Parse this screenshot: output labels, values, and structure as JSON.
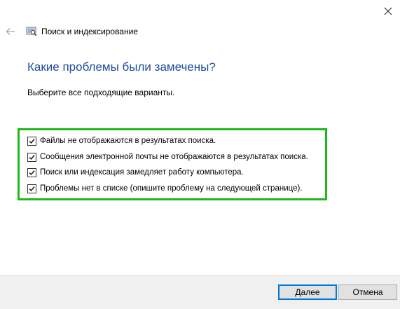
{
  "window": {
    "title": "Поиск и индексирование",
    "close_icon": "close-icon",
    "back_icon": "back-arrow-icon",
    "app_icon": "search-indexing-icon"
  },
  "main": {
    "heading": "Какие проблемы были замечены?",
    "instruction": "Выберите все подходящие варианты.",
    "highlight_color": "#1fb81a",
    "heading_color": "#1e4fa0",
    "options": [
      {
        "label": "Файлы не отображаются в результатах поиска.",
        "checked": true
      },
      {
        "label": "Сообщения электронной почты не отображаются в результатах поиска.",
        "checked": true
      },
      {
        "label": "Поиск или индексация замедляет работу компьютера.",
        "checked": true
      },
      {
        "label": "Проблемы нет в списке (опишите проблему на следующей странице).",
        "checked": true
      }
    ]
  },
  "footer": {
    "next_label_mnemonic": "Д",
    "next_label_rest": "алее",
    "cancel_label": "Отмена",
    "accent_color": "#0078d7"
  }
}
